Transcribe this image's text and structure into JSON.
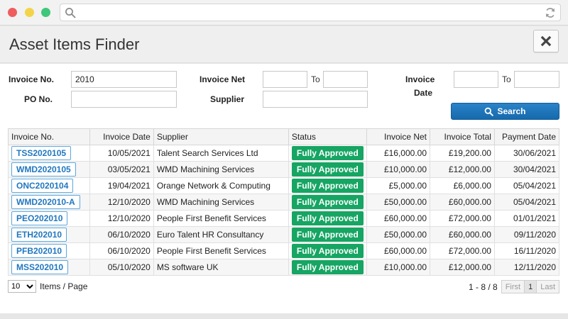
{
  "window": {
    "accent": "#1669ad",
    "status_color": "#16a563"
  },
  "panel": {
    "title": "Asset Items Finder"
  },
  "filters": {
    "invoice_no_label": "Invoice No.",
    "invoice_no_value": "2010",
    "po_no_label": "PO No.",
    "po_no_value": "",
    "invoice_net_label": "Invoice Net",
    "invoice_net_to": "To",
    "supplier_label": "Supplier",
    "supplier_value": "",
    "invoice_date_label_1": "Invoice",
    "invoice_date_label_2": "Date",
    "invoice_date_to": "To",
    "search_label": "Search"
  },
  "table": {
    "headers": [
      "Invoice No.",
      "Invoice Date",
      "Supplier",
      "Status",
      "Invoice Net",
      "Invoice Total",
      "Payment Date"
    ],
    "rows": [
      {
        "invoice_no": "TSS2020105",
        "invoice_date": "10/05/2021",
        "supplier": "Talent Search Services Ltd",
        "status": "Fully Approved",
        "net": "£16,000.00",
        "total": "£19,200.00",
        "payment_date": "30/06/2021"
      },
      {
        "invoice_no": "WMD2020105",
        "invoice_date": "03/05/2021",
        "supplier": "WMD Machining Services",
        "status": "Fully Approved",
        "net": "£10,000.00",
        "total": "£12,000.00",
        "payment_date": "30/04/2021"
      },
      {
        "invoice_no": "ONC2020104",
        "invoice_date": "19/04/2021",
        "supplier": "Orange Network & Computing",
        "status": "Fully Approved",
        "net": "£5,000.00",
        "total": "£6,000.00",
        "payment_date": "05/04/2021"
      },
      {
        "invoice_no": "WMD202010-A",
        "invoice_date": "12/10/2020",
        "supplier": "WMD Machining Services",
        "status": "Fully Approved",
        "net": "£50,000.00",
        "total": "£60,000.00",
        "payment_date": "05/04/2021"
      },
      {
        "invoice_no": "PEO202010",
        "invoice_date": "12/10/2020",
        "supplier": "People First Benefit Services",
        "status": "Fully Approved",
        "net": "£60,000.00",
        "total": "£72,000.00",
        "payment_date": "01/01/2021"
      },
      {
        "invoice_no": "ETH202010",
        "invoice_date": "06/10/2020",
        "supplier": "Euro Talent HR Consultancy",
        "status": "Fully Approved",
        "net": "£50,000.00",
        "total": "£60,000.00",
        "payment_date": "09/11/2020"
      },
      {
        "invoice_no": "PFB202010",
        "invoice_date": "06/10/2020",
        "supplier": "People First Benefit Services",
        "status": "Fully Approved",
        "net": "£60,000.00",
        "total": "£72,000.00",
        "payment_date": "16/11/2020"
      },
      {
        "invoice_no": "MSS202010",
        "invoice_date": "05/10/2020",
        "supplier": "MS software UK",
        "status": "Fully Approved",
        "net": "£10,000.00",
        "total": "£12,000.00",
        "payment_date": "12/11/2020"
      }
    ]
  },
  "pager": {
    "per_page": "10",
    "items_label": "Items / Page",
    "range": "1 - 8 / 8",
    "first": "First",
    "current": "1",
    "last": "Last"
  }
}
